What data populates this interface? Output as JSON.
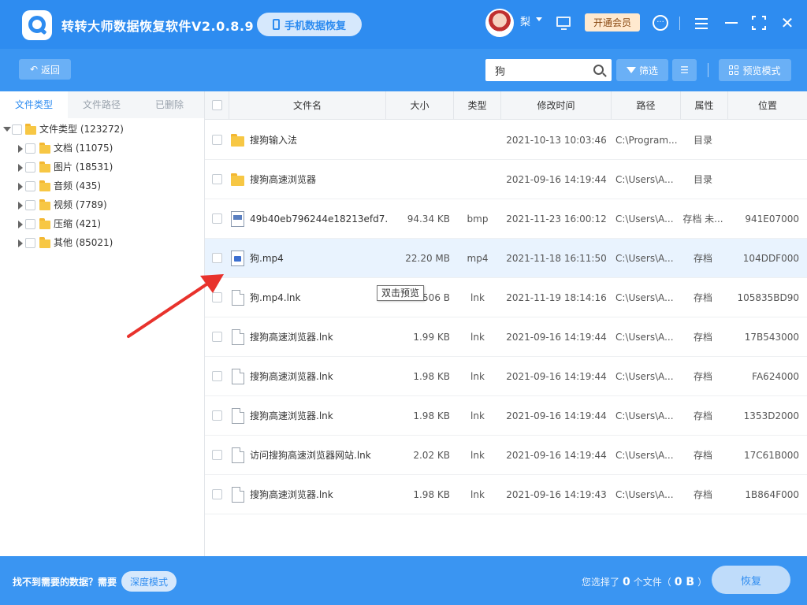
{
  "app": {
    "title": "转转大师数据恢复软件V2.0.8.9",
    "phone_recovery_label": "手机数据恢复",
    "username": "梨",
    "vip_label": "开通会员"
  },
  "toolbar": {
    "back_label": "返回",
    "search_value": "狗",
    "filter_label": "筛选",
    "preview_mode_label": "预览模式"
  },
  "sidebar": {
    "tabs": [
      {
        "label": "文件类型",
        "active": true
      },
      {
        "label": "文件路径",
        "active": false
      },
      {
        "label": "已删除",
        "active": false
      }
    ],
    "tree": [
      {
        "label": "文件类型 (123272)",
        "level": 0,
        "expanded": true
      },
      {
        "label": "文档 (11075)",
        "level": 1,
        "expanded": false
      },
      {
        "label": "图片 (18531)",
        "level": 1,
        "expanded": false
      },
      {
        "label": "音频 (435)",
        "level": 1,
        "expanded": false
      },
      {
        "label": "视频 (7789)",
        "level": 1,
        "expanded": false
      },
      {
        "label": "压缩 (421)",
        "level": 1,
        "expanded": false
      },
      {
        "label": "其他 (85021)",
        "level": 1,
        "expanded": false
      }
    ]
  },
  "table": {
    "columns": [
      "文件名",
      "大小",
      "类型",
      "修改时间",
      "路径",
      "属性",
      "位置"
    ],
    "rows": [
      {
        "icon": "folder",
        "name": "搜狗输入法",
        "size": "",
        "type": "",
        "mtime": "2021-10-13 10:03:46",
        "path": "C:\\Program...",
        "attr": "目录",
        "pos": ""
      },
      {
        "icon": "folder",
        "name": "搜狗高速浏览器",
        "size": "",
        "type": "",
        "mtime": "2021-09-16 14:19:44",
        "path": "C:\\Users\\A...",
        "attr": "目录",
        "pos": ""
      },
      {
        "icon": "image",
        "name": "49b40eb796244e18213efd7...",
        "size": "94.34 KB",
        "type": "bmp",
        "mtime": "2021-11-23 16:00:12",
        "path": "C:\\Users\\A...",
        "attr": "存档 未...",
        "pos": "941E07000"
      },
      {
        "icon": "video",
        "name": "狗.mp4",
        "size": "22.20 MB",
        "type": "mp4",
        "mtime": "2021-11-18 16:11:50",
        "path": "C:\\Users\\A...",
        "attr": "存档",
        "pos": "104DDF000",
        "highlight": true
      },
      {
        "icon": "file",
        "name": "狗.mp4.lnk",
        "size": "506 B",
        "type": "lnk",
        "mtime": "2021-11-19 18:14:16",
        "path": "C:\\Users\\A...",
        "attr": "存档",
        "pos": "105835BD90"
      },
      {
        "icon": "file",
        "name": "搜狗高速浏览器.lnk",
        "size": "1.99 KB",
        "type": "lnk",
        "mtime": "2021-09-16 14:19:44",
        "path": "C:\\Users\\A...",
        "attr": "存档",
        "pos": "17B543000"
      },
      {
        "icon": "file",
        "name": "搜狗高速浏览器.lnk",
        "size": "1.98 KB",
        "type": "lnk",
        "mtime": "2021-09-16 14:19:44",
        "path": "C:\\Users\\A...",
        "attr": "存档",
        "pos": "FA624000"
      },
      {
        "icon": "file",
        "name": "搜狗高速浏览器.lnk",
        "size": "1.98 KB",
        "type": "lnk",
        "mtime": "2021-09-16 14:19:44",
        "path": "C:\\Users\\A...",
        "attr": "存档",
        "pos": "1353D2000"
      },
      {
        "icon": "file",
        "name": "访问搜狗高速浏览器网站.lnk",
        "size": "2.02 KB",
        "type": "lnk",
        "mtime": "2021-09-16 14:19:44",
        "path": "C:\\Users\\A...",
        "attr": "存档",
        "pos": "17C61B000"
      },
      {
        "icon": "file",
        "name": "搜狗高速浏览器.lnk",
        "size": "1.98 KB",
        "type": "lnk",
        "mtime": "2021-09-16 14:19:43",
        "path": "C:\\Users\\A...",
        "attr": "存档",
        "pos": "1B864F000"
      }
    ]
  },
  "tooltip": "双击预览",
  "footer": {
    "hint": "找不到需要的数据？需要",
    "deep_mode_label": "深度模式",
    "selected_prefix": "您选择了",
    "selected_count": "0",
    "selected_mid": "个文件（",
    "selected_size": "0 B",
    "selected_suffix": "）",
    "recover_label": "恢复"
  },
  "colors": {
    "primary": "#2e8cf0",
    "annotation_arrow": "#e8322c"
  }
}
